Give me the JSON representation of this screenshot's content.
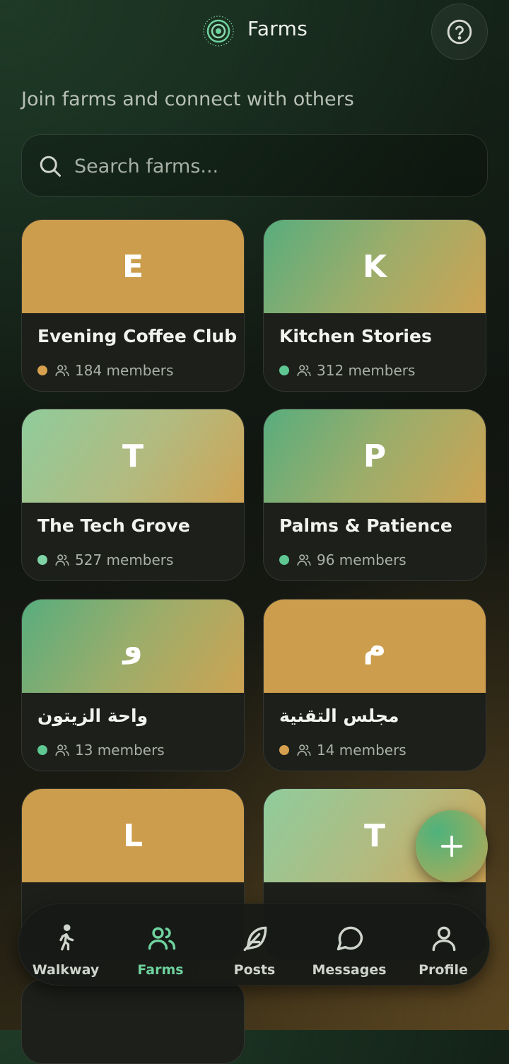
{
  "header": {
    "title": "Farms",
    "logo_icon": "radar-logo-icon",
    "help_icon": "question-circle-icon"
  },
  "subtitle": "Join farms and connect with others",
  "search": {
    "placeholder": "Search farms...",
    "value": ""
  },
  "farms": [
    {
      "initial": "E",
      "name": "Evening Coffee Club",
      "members": "184 members",
      "dot_color": "amber",
      "banner": "amber"
    },
    {
      "initial": "K",
      "name": "Kitchen Stories",
      "members": "312 members",
      "dot_color": "green",
      "banner": "green-amber"
    },
    {
      "initial": "T",
      "name": "The Tech Grove",
      "members": "527 members",
      "dot_color": "mint",
      "banner": "mint-amber"
    },
    {
      "initial": "P",
      "name": "Palms & Patience",
      "members": "96 members",
      "dot_color": "green",
      "banner": "green-amber"
    },
    {
      "initial": "و",
      "name": "واحة الزيتون",
      "members": "13 members",
      "dot_color": "green",
      "banner": "green-amber"
    },
    {
      "initial": "م",
      "name": "مجلس التقنية",
      "members": "14 members",
      "dot_color": "amber",
      "banner": "amber"
    },
    {
      "initial": "L",
      "name": "",
      "members": "",
      "banner": "amber"
    },
    {
      "initial": "T",
      "name": "",
      "members": "",
      "banner": "mint-amber"
    }
  ],
  "fab": {
    "icon": "plus-icon"
  },
  "nav": {
    "items": [
      {
        "label": "Walkway",
        "icon": "walking-person-icon",
        "active": false
      },
      {
        "label": "Farms",
        "icon": "users-icon",
        "active": true
      },
      {
        "label": "Posts",
        "icon": "feather-icon",
        "active": false
      },
      {
        "label": "Messages",
        "icon": "chat-bubble-icon",
        "active": false
      },
      {
        "label": "Profile",
        "icon": "user-icon",
        "active": false
      }
    ]
  },
  "colors": {
    "accent_green": "#5fc792",
    "accent_amber": "#d6a04f",
    "nav_active": "#6fd39f"
  }
}
